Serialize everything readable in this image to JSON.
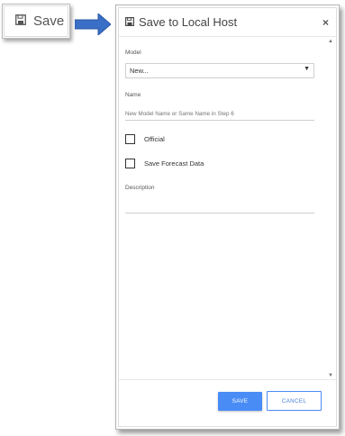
{
  "callout": {
    "label": "Save",
    "icon": "floppy-disk-icon"
  },
  "arrow_color": "#3a6fc7",
  "dialog": {
    "title": "Save to Local Host",
    "title_icon": "floppy-disk-icon",
    "close_label": "×",
    "model": {
      "label": "Model",
      "value": "New..."
    },
    "name": {
      "label": "Name",
      "placeholder": "New Model Name or Same Name in Step 6"
    },
    "checkboxes": [
      {
        "label": "Official",
        "checked": false
      },
      {
        "label": "Save Forecast Data",
        "checked": false
      }
    ],
    "description": {
      "label": "Description",
      "value": ""
    },
    "buttons": {
      "save": "SAVE",
      "cancel": "CANCEL"
    },
    "accent_color": "#4a8cf6"
  }
}
